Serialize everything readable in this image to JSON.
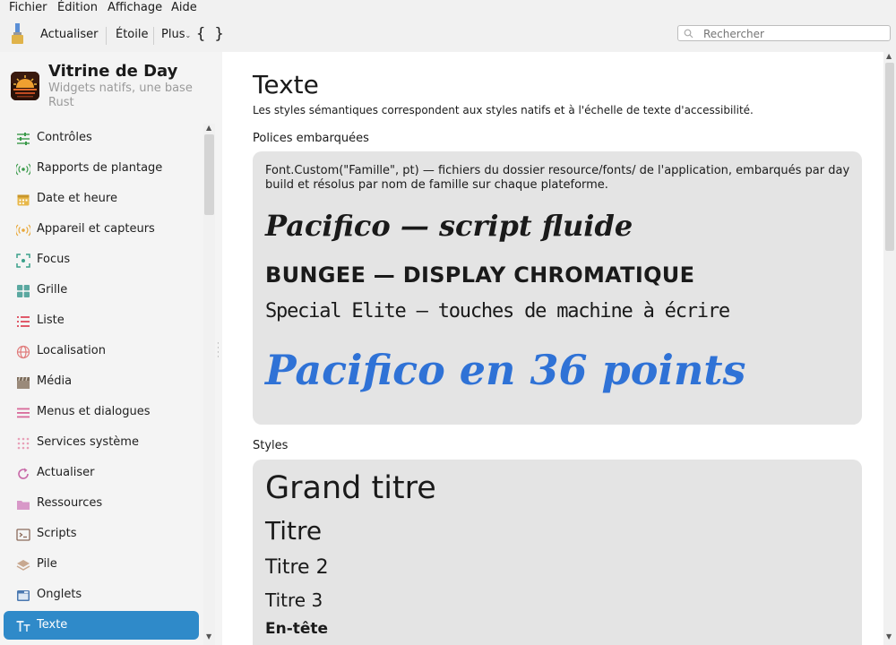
{
  "menu": [
    "Fichier",
    "Édition",
    "Affichage",
    "Aide"
  ],
  "toolbar": {
    "refresh_label": "Actualiser",
    "star_label": "Étoile",
    "more_label": "Plus",
    "braces_label": "{ }",
    "search_placeholder": "Rechercher"
  },
  "sidebar": {
    "app_title": "Vitrine de Day",
    "app_subtitle": "Widgets natifs, une base Rust",
    "items": [
      {
        "label": "Contrôles",
        "icon": "sliders-icon"
      },
      {
        "label": "Rapports de plantage",
        "icon": "broadcast-icon"
      },
      {
        "label": "Date et heure",
        "icon": "calendar-icon"
      },
      {
        "label": "Appareil et capteurs",
        "icon": "sensor-icon"
      },
      {
        "label": "Focus",
        "icon": "focus-icon"
      },
      {
        "label": "Grille",
        "icon": "grid-icon"
      },
      {
        "label": "Liste",
        "icon": "list-icon"
      },
      {
        "label": "Localisation",
        "icon": "globe-icon"
      },
      {
        "label": "Média",
        "icon": "clapper-icon"
      },
      {
        "label": "Menus et dialogues",
        "icon": "menu-icon"
      },
      {
        "label": "Services système",
        "icon": "dots-grid-icon"
      },
      {
        "label": "Actualiser",
        "icon": "refresh-icon"
      },
      {
        "label": "Ressources",
        "icon": "folder-icon"
      },
      {
        "label": "Scripts",
        "icon": "terminal-icon"
      },
      {
        "label": "Pile",
        "icon": "stack-icon"
      },
      {
        "label": "Onglets",
        "icon": "tabs-icon"
      },
      {
        "label": "Texte",
        "icon": "text-icon",
        "active": true
      }
    ]
  },
  "main": {
    "title": "Texte",
    "description": "Les styles sémantiques correspondent aux styles natifs et à l'échelle de texte d'accessibilité.",
    "embedded_title": "Polices embarquées",
    "embedded_desc": "Font.Custom(\"Famille\", pt) — fichiers du dossier resource/fonts/ de l'application, embarqués par day build et résolus par nom de famille sur chaque plateforme.",
    "font_samples": [
      "Pacifico — script fluide",
      "Bungee — display chromatique",
      "Special Elite — touches de machine à écrire",
      "Pacifico en 36 points"
    ],
    "styles_title": "Styles",
    "styles": [
      "Grand titre",
      "Titre",
      "Titre 2",
      "Titre 3",
      "En-tête"
    ]
  },
  "colors": {
    "accent": "#2f8ac9",
    "big_sample": "#2f72d6"
  }
}
